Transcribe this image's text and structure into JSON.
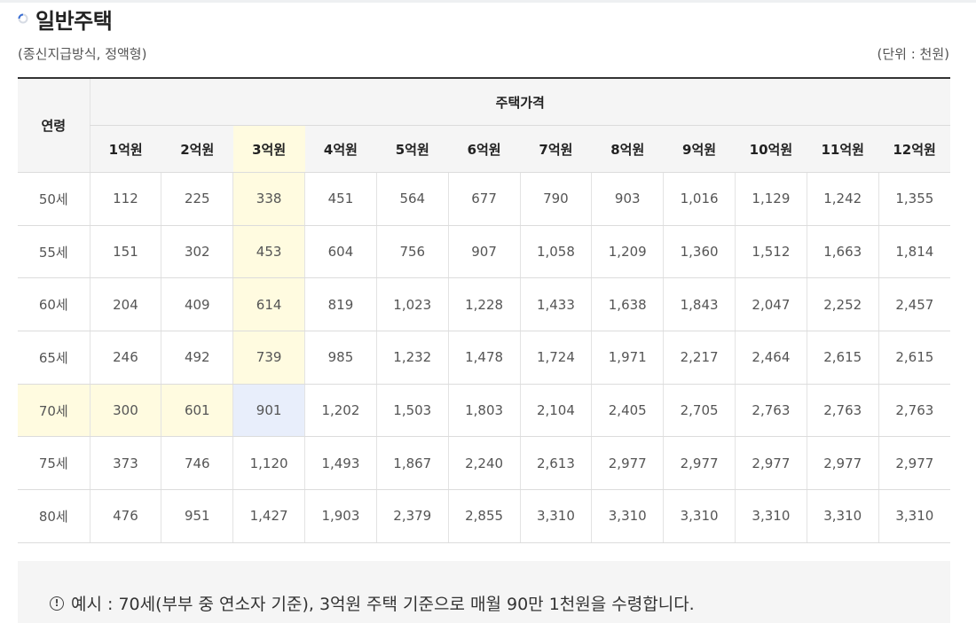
{
  "title": "일반주택",
  "subtitle_left": "(종신지급방식, 정액형)",
  "subtitle_right": "(단위 : 천원)",
  "table": {
    "age_header": "연령",
    "price_header": "주택가격",
    "columns": [
      "1억원",
      "2억원",
      "3억원",
      "4억원",
      "5억원",
      "6억원",
      "7억원",
      "8억원",
      "9억원",
      "10억원",
      "11억원",
      "12억원"
    ],
    "rows": [
      {
        "age": "50세",
        "values": [
          "112",
          "225",
          "338",
          "451",
          "564",
          "677",
          "790",
          "903",
          "1,016",
          "1,129",
          "1,242",
          "1,355"
        ]
      },
      {
        "age": "55세",
        "values": [
          "151",
          "302",
          "453",
          "604",
          "756",
          "907",
          "1,058",
          "1,209",
          "1,360",
          "1,512",
          "1,663",
          "1,814"
        ]
      },
      {
        "age": "60세",
        "values": [
          "204",
          "409",
          "614",
          "819",
          "1,023",
          "1,228",
          "1,433",
          "1,638",
          "1,843",
          "2,047",
          "2,252",
          "2,457"
        ]
      },
      {
        "age": "65세",
        "values": [
          "246",
          "492",
          "739",
          "985",
          "1,232",
          "1,478",
          "1,724",
          "1,971",
          "2,217",
          "2,464",
          "2,615",
          "2,615"
        ]
      },
      {
        "age": "70세",
        "values": [
          "300",
          "601",
          "901",
          "1,202",
          "1,503",
          "1,803",
          "2,104",
          "2,405",
          "2,705",
          "2,763",
          "2,763",
          "2,763"
        ]
      },
      {
        "age": "75세",
        "values": [
          "373",
          "746",
          "1,120",
          "1,493",
          "1,867",
          "2,240",
          "2,613",
          "2,977",
          "2,977",
          "2,977",
          "2,977",
          "2,977"
        ]
      },
      {
        "age": "80세",
        "values": [
          "476",
          "951",
          "1,427",
          "1,903",
          "2,379",
          "2,855",
          "3,310",
          "3,310",
          "3,310",
          "3,310",
          "3,310",
          "3,310"
        ]
      }
    ],
    "highlight": {
      "row_index": 4,
      "column_index": 2
    }
  },
  "note": {
    "icon": "info-icon",
    "text": "예시 : 70세(부부 중 연소자 기준), 3억원 주택 기준으로 매월 90만 1천원을 수령합니다."
  },
  "colors": {
    "highlight_yellow": "#fffbe0",
    "highlight_blue": "#e8eefb",
    "header_bg": "#f5f5f5"
  }
}
